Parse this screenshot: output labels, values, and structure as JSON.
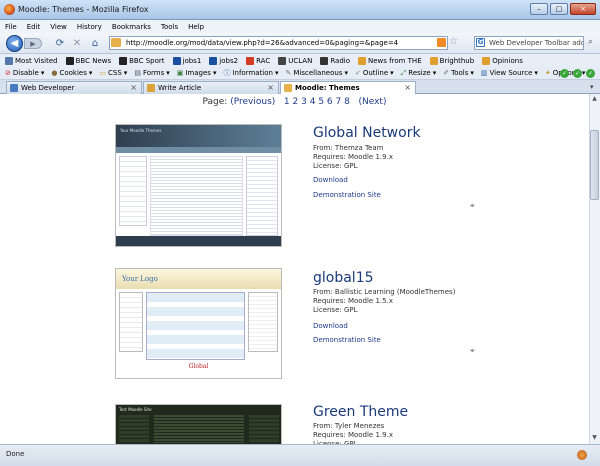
{
  "window": {
    "title": "Moodle: Themes - Mozilla Firefox",
    "min": "–",
    "max": "□",
    "close": "×"
  },
  "menu": [
    "File",
    "Edit",
    "View",
    "History",
    "Bookmarks",
    "Tools",
    "Help"
  ],
  "nav": {
    "url": "http://moodle.org/mod/data/view.php?d=26&advanced=0&paging=&page=4",
    "search_value": "Web Developer Toolbar add-o"
  },
  "bookmarks": [
    {
      "label": "Most Visited",
      "color": "#5577aa"
    },
    {
      "label": "BBC News",
      "color": "#222222"
    },
    {
      "label": "BBC Sport",
      "color": "#222222"
    },
    {
      "label": "jobs1",
      "color": "#1d4fa0"
    },
    {
      "label": "jobs2",
      "color": "#1d4fa0"
    },
    {
      "label": "RAC",
      "color": "#d33b24"
    },
    {
      "label": "UCLAN",
      "color": "#444444"
    },
    {
      "label": "Radio",
      "color": "#333333"
    },
    {
      "label": "News from THE",
      "color": "#e0a030"
    },
    {
      "label": "Brighthub",
      "color": "#e0a030"
    },
    {
      "label": "Opinions",
      "color": "#e0a030"
    }
  ],
  "webdev": [
    "Disable",
    "Cookies",
    "CSS",
    "Forms",
    "Images",
    "Information",
    "Miscellaneous",
    "Outline",
    "Resize",
    "Tools",
    "View Source",
    "Options"
  ],
  "tabs": [
    {
      "label": "Web Developer",
      "color": "#4a7bc0",
      "active": false
    },
    {
      "label": "Write Article",
      "color": "#d9a43a",
      "active": false
    },
    {
      "label": "Moodle: Themes",
      "color": "#e8b04c",
      "active": true
    }
  ],
  "pager": {
    "label": "Page:",
    "prev": "(Previous)",
    "pages": [
      "1",
      "2",
      "3",
      "4",
      "5",
      "6",
      "7",
      "8"
    ],
    "next": "(Next)"
  },
  "themes": [
    {
      "name": "Global Network",
      "from": "From: Themza Team",
      "requires": "Requires: Moodle 1.9.x",
      "license": "License: GPL",
      "download": "Download",
      "demo": "Demonstration Site",
      "preview_title": "Your Moodle Themes"
    },
    {
      "name": "global15",
      "from": "From: Ballistic Learning (MoodleThemes)",
      "requires": "Requires: Moodle 1.5.x",
      "license": "License: GPL",
      "download": "Download",
      "demo": "Demonstration Site",
      "preview_title": "Your Logo",
      "preview_footer": "Global"
    },
    {
      "name": "Green Theme",
      "from": "From: Tyler Menezes",
      "requires": "Requires: Moodle 1.9.x",
      "license": "License: GPL",
      "preview_title": "Test Moodle Site"
    }
  ],
  "status": "Done"
}
